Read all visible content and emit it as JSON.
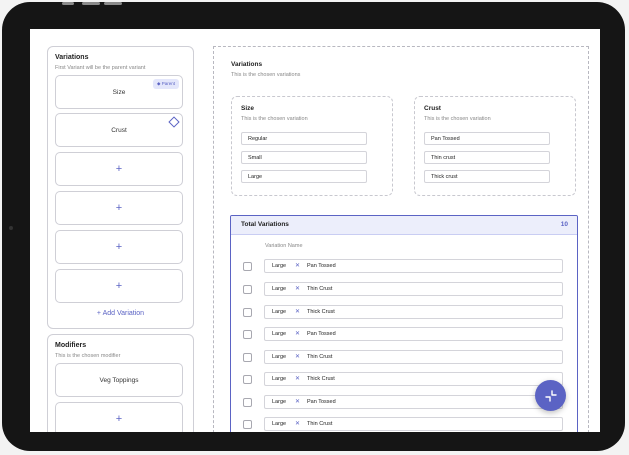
{
  "variations_panel": {
    "title": "Variations",
    "subtitle": "First Variant will be the parent variant",
    "items": [
      {
        "label": "Size",
        "badge": "Parent"
      },
      {
        "label": "Crust"
      },
      {
        "label": "+"
      },
      {
        "label": "+"
      },
      {
        "label": "+"
      },
      {
        "label": "+"
      }
    ],
    "add_label": "+ Add Variation"
  },
  "modifiers_panel": {
    "title": "Modifiers",
    "subtitle": "This is the chosen modifier",
    "items": [
      {
        "label": "Veg Toppings"
      },
      {
        "label": "+"
      }
    ]
  },
  "main": {
    "title": "Variations",
    "subtitle": "This is the chosen variations",
    "size_card": {
      "title": "Size",
      "subtitle": "This is the chosen variation",
      "options": [
        "Regular",
        "Small",
        "Large"
      ]
    },
    "crust_card": {
      "title": "Crust",
      "subtitle": "This is the chosen variation",
      "options": [
        "Pan Tossed",
        "Thin crust",
        "Thick crust"
      ]
    },
    "total": {
      "title": "Total Variations",
      "count": "10",
      "column_header": "Variation Name",
      "rows": [
        {
          "size": "Large",
          "sep": "✕",
          "crust": "Pan Tossed"
        },
        {
          "size": "Large",
          "sep": "✕",
          "crust": "Thin Crust"
        },
        {
          "size": "Large",
          "sep": "✕",
          "crust": "Thick Crust"
        },
        {
          "size": "Large",
          "sep": "✕",
          "crust": "Pan Tossed"
        },
        {
          "size": "Large",
          "sep": "✕",
          "crust": "Thin Crust"
        },
        {
          "size": "Large",
          "sep": "✕",
          "crust": "Thick Crust"
        },
        {
          "size": "Large",
          "sep": "✕",
          "crust": "Pan Tossed"
        },
        {
          "size": "Large",
          "sep": "✕",
          "crust": "Thin Crust"
        }
      ]
    }
  },
  "fab": {
    "icon": "collapse-icon"
  },
  "colors": {
    "accent": "#5b63c4",
    "accent_light": "#eceefb"
  }
}
